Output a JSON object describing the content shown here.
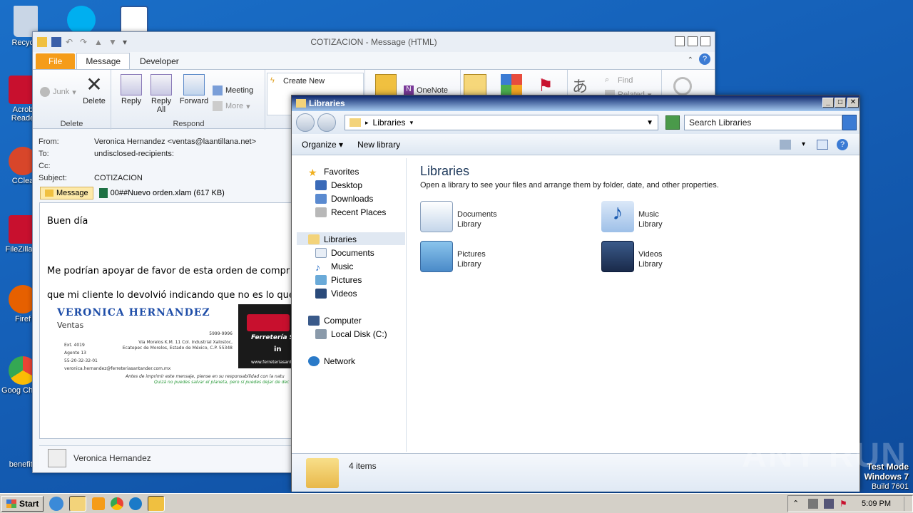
{
  "desktop": {
    "icons": [
      {
        "label": "Recycle",
        "color": "#c9d6e6"
      },
      {
        "label": "Acrob Reade",
        "color": "#c8102e"
      },
      {
        "label": "CClea",
        "color": "#d8462a"
      },
      {
        "label": "FileZilla C",
        "color": "#c8102e"
      },
      {
        "label": "Firef",
        "color": "#e66000"
      },
      {
        "label": "Goog Chron",
        "color": "#34a853"
      },
      {
        "label": "benefits",
        "color": "#1560b8"
      }
    ]
  },
  "outlook": {
    "title": "COTIZACION  -  Message (HTML)",
    "tabs": {
      "file": "File",
      "message": "Message",
      "developer": "Developer"
    },
    "ribbon": {
      "junk": "Junk",
      "delete": "Delete",
      "group_delete": "Delete",
      "reply": "Reply",
      "reply_all": "Reply All",
      "forward": "Forward",
      "meeting": "Meeting",
      "more": "More",
      "group_respond": "Respond",
      "create_new": "Create New",
      "onenote": "OneNote",
      "find": "Find",
      "related": "Related"
    },
    "headers": {
      "from_label": "From:",
      "from_value": "Veronica Hernandez <ventas@laantillana.net>",
      "to_label": "To:",
      "to_value": "undisclosed-recipients:",
      "cc_label": "Cc:",
      "cc_value": "",
      "subject_label": "Subject:",
      "subject_value": "COTIZACION"
    },
    "message_tab": "Message",
    "attachment": "00##Nuevo orden.xlam (617 KB)",
    "body": {
      "greeting": "Buen día",
      "line1": "Me podrían apoyar de favor de esta orden de compr",
      "line2": "que mi cliente lo devolvió indicando que no es lo que"
    },
    "signature": {
      "name": "VERONICA HERNANDEZ",
      "role": "Ventas",
      "ext": "Ext. 4019",
      "agent": "Agente 13",
      "phone": "55-20-32-32-01",
      "email": "veronica.hernandez@ferreteriasantander.com.mx",
      "phone2": "5999-9996",
      "addr1": "Via Morelos K.M. 11 Col. Industrial Xalostoc,",
      "addr2": "Ecatepec de Morelos, Estado de México, C.P. 55348",
      "logo_text": "Ferretería S",
      "logo_url": "www.ferreteriasant",
      "foot1": "Antes de imprimir este mensaje, piense en su responsabilidad con la natu",
      "foot2": "Quizá no puedes salvar el planeta, pero sí puedes dejar de dec"
    },
    "people_pane_name": "Veronica Hernandez"
  },
  "explorer": {
    "title": "Libraries",
    "address": "Libraries",
    "search_placeholder": "Search Libraries",
    "organize": "Organize",
    "new_library": "New library",
    "nav": {
      "favorites": "Favorites",
      "desktop": "Desktop",
      "downloads": "Downloads",
      "recent": "Recent Places",
      "libraries": "Libraries",
      "documents": "Documents",
      "music": "Music",
      "pictures": "Pictures",
      "videos": "Videos",
      "computer": "Computer",
      "localdisk": "Local Disk (C:)",
      "network": "Network"
    },
    "content_title": "Libraries",
    "content_subtitle": "Open a library to see your files and arrange them by folder, date, and other properties.",
    "libraries": [
      {
        "name": "Documents",
        "type": "Library"
      },
      {
        "name": "Music",
        "type": "Library"
      },
      {
        "name": "Pictures",
        "type": "Library"
      },
      {
        "name": "Videos",
        "type": "Library"
      }
    ],
    "status": "4 items"
  },
  "system": {
    "watermark": "ANY RUN",
    "test_mode": "Test Mode",
    "os": "Windows 7",
    "build": "Build 7601",
    "start": "Start",
    "clock": "5:09 PM"
  }
}
